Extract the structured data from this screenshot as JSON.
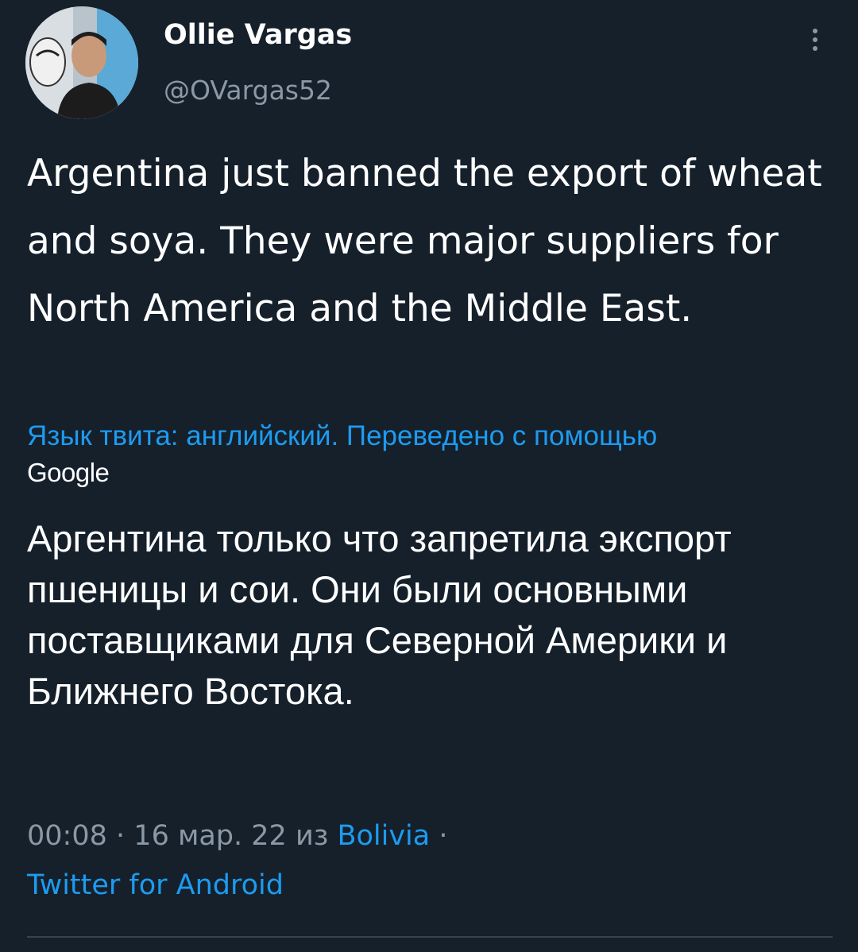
{
  "author": {
    "name": "Ollie Vargas",
    "handle": "@OVargas52"
  },
  "tweet": {
    "text": "Argentina just banned the export of wheat and soya. They were major suppliers for North America and the Middle East.",
    "translation_note": "Язык твита: английский. Переведено с помощью",
    "translation_provider": "Google",
    "translated_text": "Аргентина только что запретила экспорт пшеницы и сои. Они были основными поставщиками для Северной Америки и Ближнего Востока."
  },
  "meta": {
    "time": "00:08",
    "separator": "·",
    "date": "16 мар. 22",
    "from_word": "из",
    "location": "Bolivia",
    "source": "Twitter for Android"
  },
  "icons": {
    "more": "more-vertical-icon",
    "avatar": "user-avatar"
  },
  "colors": {
    "background": "#15202b",
    "text": "#ffffff",
    "secondary": "#8b98a5",
    "accent": "#1d9bf0",
    "divider": "#38444d"
  }
}
